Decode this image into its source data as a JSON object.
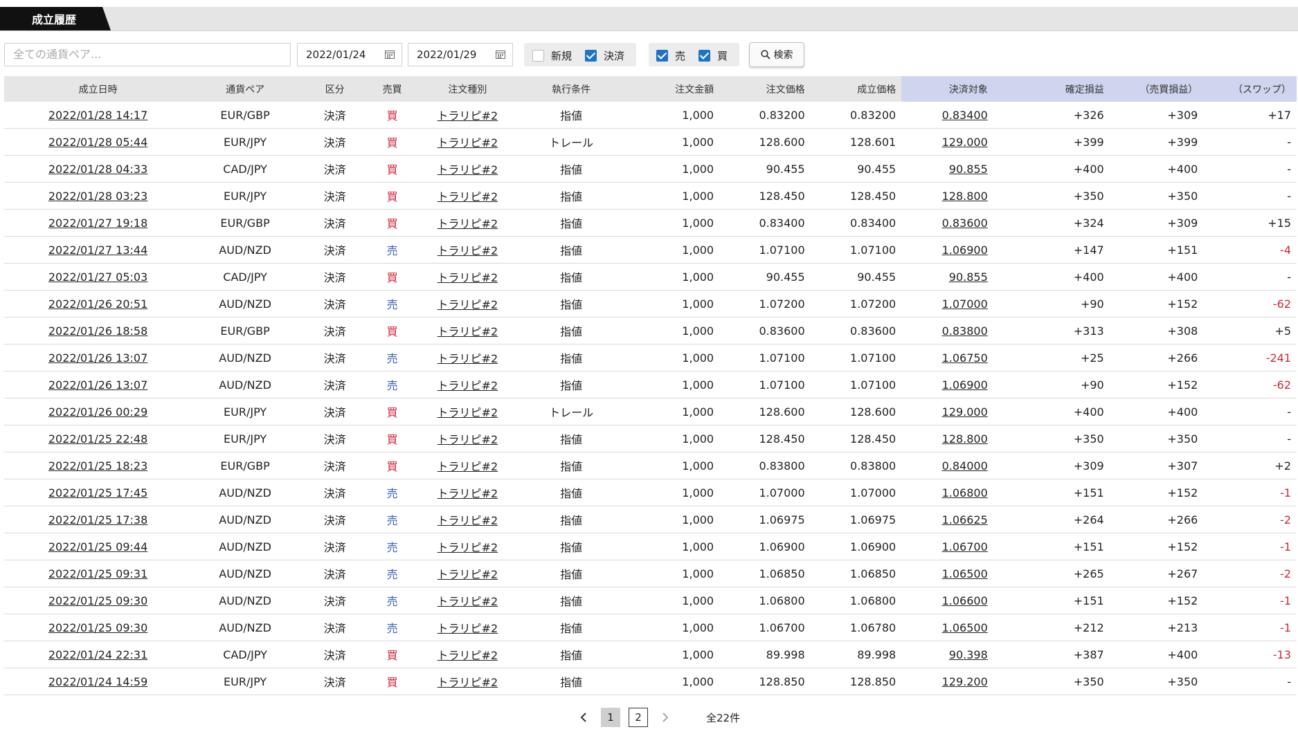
{
  "tab": {
    "label": "成立履歴"
  },
  "filters": {
    "pair_placeholder": "全ての通貨ペア...",
    "date_from": "2022/01/24",
    "date_to": "2022/01/29",
    "type_new": {
      "label": "新規",
      "checked": false
    },
    "type_close": {
      "label": "決済",
      "checked": true
    },
    "side_sell": {
      "label": "売",
      "checked": true
    },
    "side_buy": {
      "label": "買",
      "checked": true
    },
    "search_label": "検索"
  },
  "table": {
    "headers": [
      "成立日時",
      "通貨ペア",
      "区分",
      "売買",
      "注文種別",
      "執行条件",
      "注文金額",
      "注文価格",
      "成立価格",
      "決済対象",
      "確定損益",
      "（売買損益）",
      "（スワップ）"
    ],
    "rows": [
      [
        "2022/01/28 14:17",
        "EUR/GBP",
        "決済",
        "買",
        "トラリピ#2",
        "指値",
        "1,000",
        "0.83200",
        "0.83200",
        "0.83400",
        "+326",
        "+309",
        "+17"
      ],
      [
        "2022/01/28 05:44",
        "EUR/JPY",
        "決済",
        "買",
        "トラリピ#2",
        "トレール",
        "1,000",
        "128.600",
        "128.601",
        "129.000",
        "+399",
        "+399",
        "-"
      ],
      [
        "2022/01/28 04:33",
        "CAD/JPY",
        "決済",
        "買",
        "トラリピ#2",
        "指値",
        "1,000",
        "90.455",
        "90.455",
        "90.855",
        "+400",
        "+400",
        "-"
      ],
      [
        "2022/01/28 03:23",
        "EUR/JPY",
        "決済",
        "買",
        "トラリピ#2",
        "指値",
        "1,000",
        "128.450",
        "128.450",
        "128.800",
        "+350",
        "+350",
        "-"
      ],
      [
        "2022/01/27 19:18",
        "EUR/GBP",
        "決済",
        "買",
        "トラリピ#2",
        "指値",
        "1,000",
        "0.83400",
        "0.83400",
        "0.83600",
        "+324",
        "+309",
        "+15"
      ],
      [
        "2022/01/27 13:44",
        "AUD/NZD",
        "決済",
        "売",
        "トラリピ#2",
        "指値",
        "1,000",
        "1.07100",
        "1.07100",
        "1.06900",
        "+147",
        "+151",
        "-4"
      ],
      [
        "2022/01/27 05:03",
        "CAD/JPY",
        "決済",
        "買",
        "トラリピ#2",
        "指値",
        "1,000",
        "90.455",
        "90.455",
        "90.855",
        "+400",
        "+400",
        "-"
      ],
      [
        "2022/01/26 20:51",
        "AUD/NZD",
        "決済",
        "売",
        "トラリピ#2",
        "指値",
        "1,000",
        "1.07200",
        "1.07200",
        "1.07000",
        "+90",
        "+152",
        "-62"
      ],
      [
        "2022/01/26 18:58",
        "EUR/GBP",
        "決済",
        "買",
        "トラリピ#2",
        "指値",
        "1,000",
        "0.83600",
        "0.83600",
        "0.83800",
        "+313",
        "+308",
        "+5"
      ],
      [
        "2022/01/26 13:07",
        "AUD/NZD",
        "決済",
        "売",
        "トラリピ#2",
        "指値",
        "1,000",
        "1.07100",
        "1.07100",
        "1.06750",
        "+25",
        "+266",
        "-241"
      ],
      [
        "2022/01/26 13:07",
        "AUD/NZD",
        "決済",
        "売",
        "トラリピ#2",
        "指値",
        "1,000",
        "1.07100",
        "1.07100",
        "1.06900",
        "+90",
        "+152",
        "-62"
      ],
      [
        "2022/01/26 00:29",
        "EUR/JPY",
        "決済",
        "買",
        "トラリピ#2",
        "トレール",
        "1,000",
        "128.600",
        "128.600",
        "129.000",
        "+400",
        "+400",
        "-"
      ],
      [
        "2022/01/25 22:48",
        "EUR/JPY",
        "決済",
        "買",
        "トラリピ#2",
        "指値",
        "1,000",
        "128.450",
        "128.450",
        "128.800",
        "+350",
        "+350",
        "-"
      ],
      [
        "2022/01/25 18:23",
        "EUR/GBP",
        "決済",
        "買",
        "トラリピ#2",
        "指値",
        "1,000",
        "0.83800",
        "0.83800",
        "0.84000",
        "+309",
        "+307",
        "+2"
      ],
      [
        "2022/01/25 17:45",
        "AUD/NZD",
        "決済",
        "売",
        "トラリピ#2",
        "指値",
        "1,000",
        "1.07000",
        "1.07000",
        "1.06800",
        "+151",
        "+152",
        "-1"
      ],
      [
        "2022/01/25 17:38",
        "AUD/NZD",
        "決済",
        "売",
        "トラリピ#2",
        "指値",
        "1,000",
        "1.06975",
        "1.06975",
        "1.06625",
        "+264",
        "+266",
        "-2"
      ],
      [
        "2022/01/25 09:44",
        "AUD/NZD",
        "決済",
        "売",
        "トラリピ#2",
        "指値",
        "1,000",
        "1.06900",
        "1.06900",
        "1.06700",
        "+151",
        "+152",
        "-1"
      ],
      [
        "2022/01/25 09:31",
        "AUD/NZD",
        "決済",
        "売",
        "トラリピ#2",
        "指値",
        "1,000",
        "1.06850",
        "1.06850",
        "1.06500",
        "+265",
        "+267",
        "-2"
      ],
      [
        "2022/01/25 09:30",
        "AUD/NZD",
        "決済",
        "売",
        "トラリピ#2",
        "指値",
        "1,000",
        "1.06800",
        "1.06800",
        "1.06600",
        "+151",
        "+152",
        "-1"
      ],
      [
        "2022/01/25 09:30",
        "AUD/NZD",
        "決済",
        "売",
        "トラリピ#2",
        "指値",
        "1,000",
        "1.06700",
        "1.06780",
        "1.06500",
        "+212",
        "+213",
        "-1"
      ],
      [
        "2022/01/24 22:31",
        "CAD/JPY",
        "決済",
        "買",
        "トラリピ#2",
        "指値",
        "1,000",
        "89.998",
        "89.998",
        "90.398",
        "+387",
        "+400",
        "-13"
      ],
      [
        "2022/01/24 14:59",
        "EUR/JPY",
        "決済",
        "買",
        "トラリピ#2",
        "指値",
        "1,000",
        "128.850",
        "128.850",
        "129.200",
        "+350",
        "+350",
        "-"
      ]
    ]
  },
  "pager": {
    "pages": [
      "1",
      "2"
    ],
    "current": "1",
    "total": "全22件"
  },
  "colors": {
    "buy": "#d0243a",
    "sell": "#3a62b5",
    "accent": "#1f73c5",
    "highlight_header": "#cfd5ee"
  }
}
